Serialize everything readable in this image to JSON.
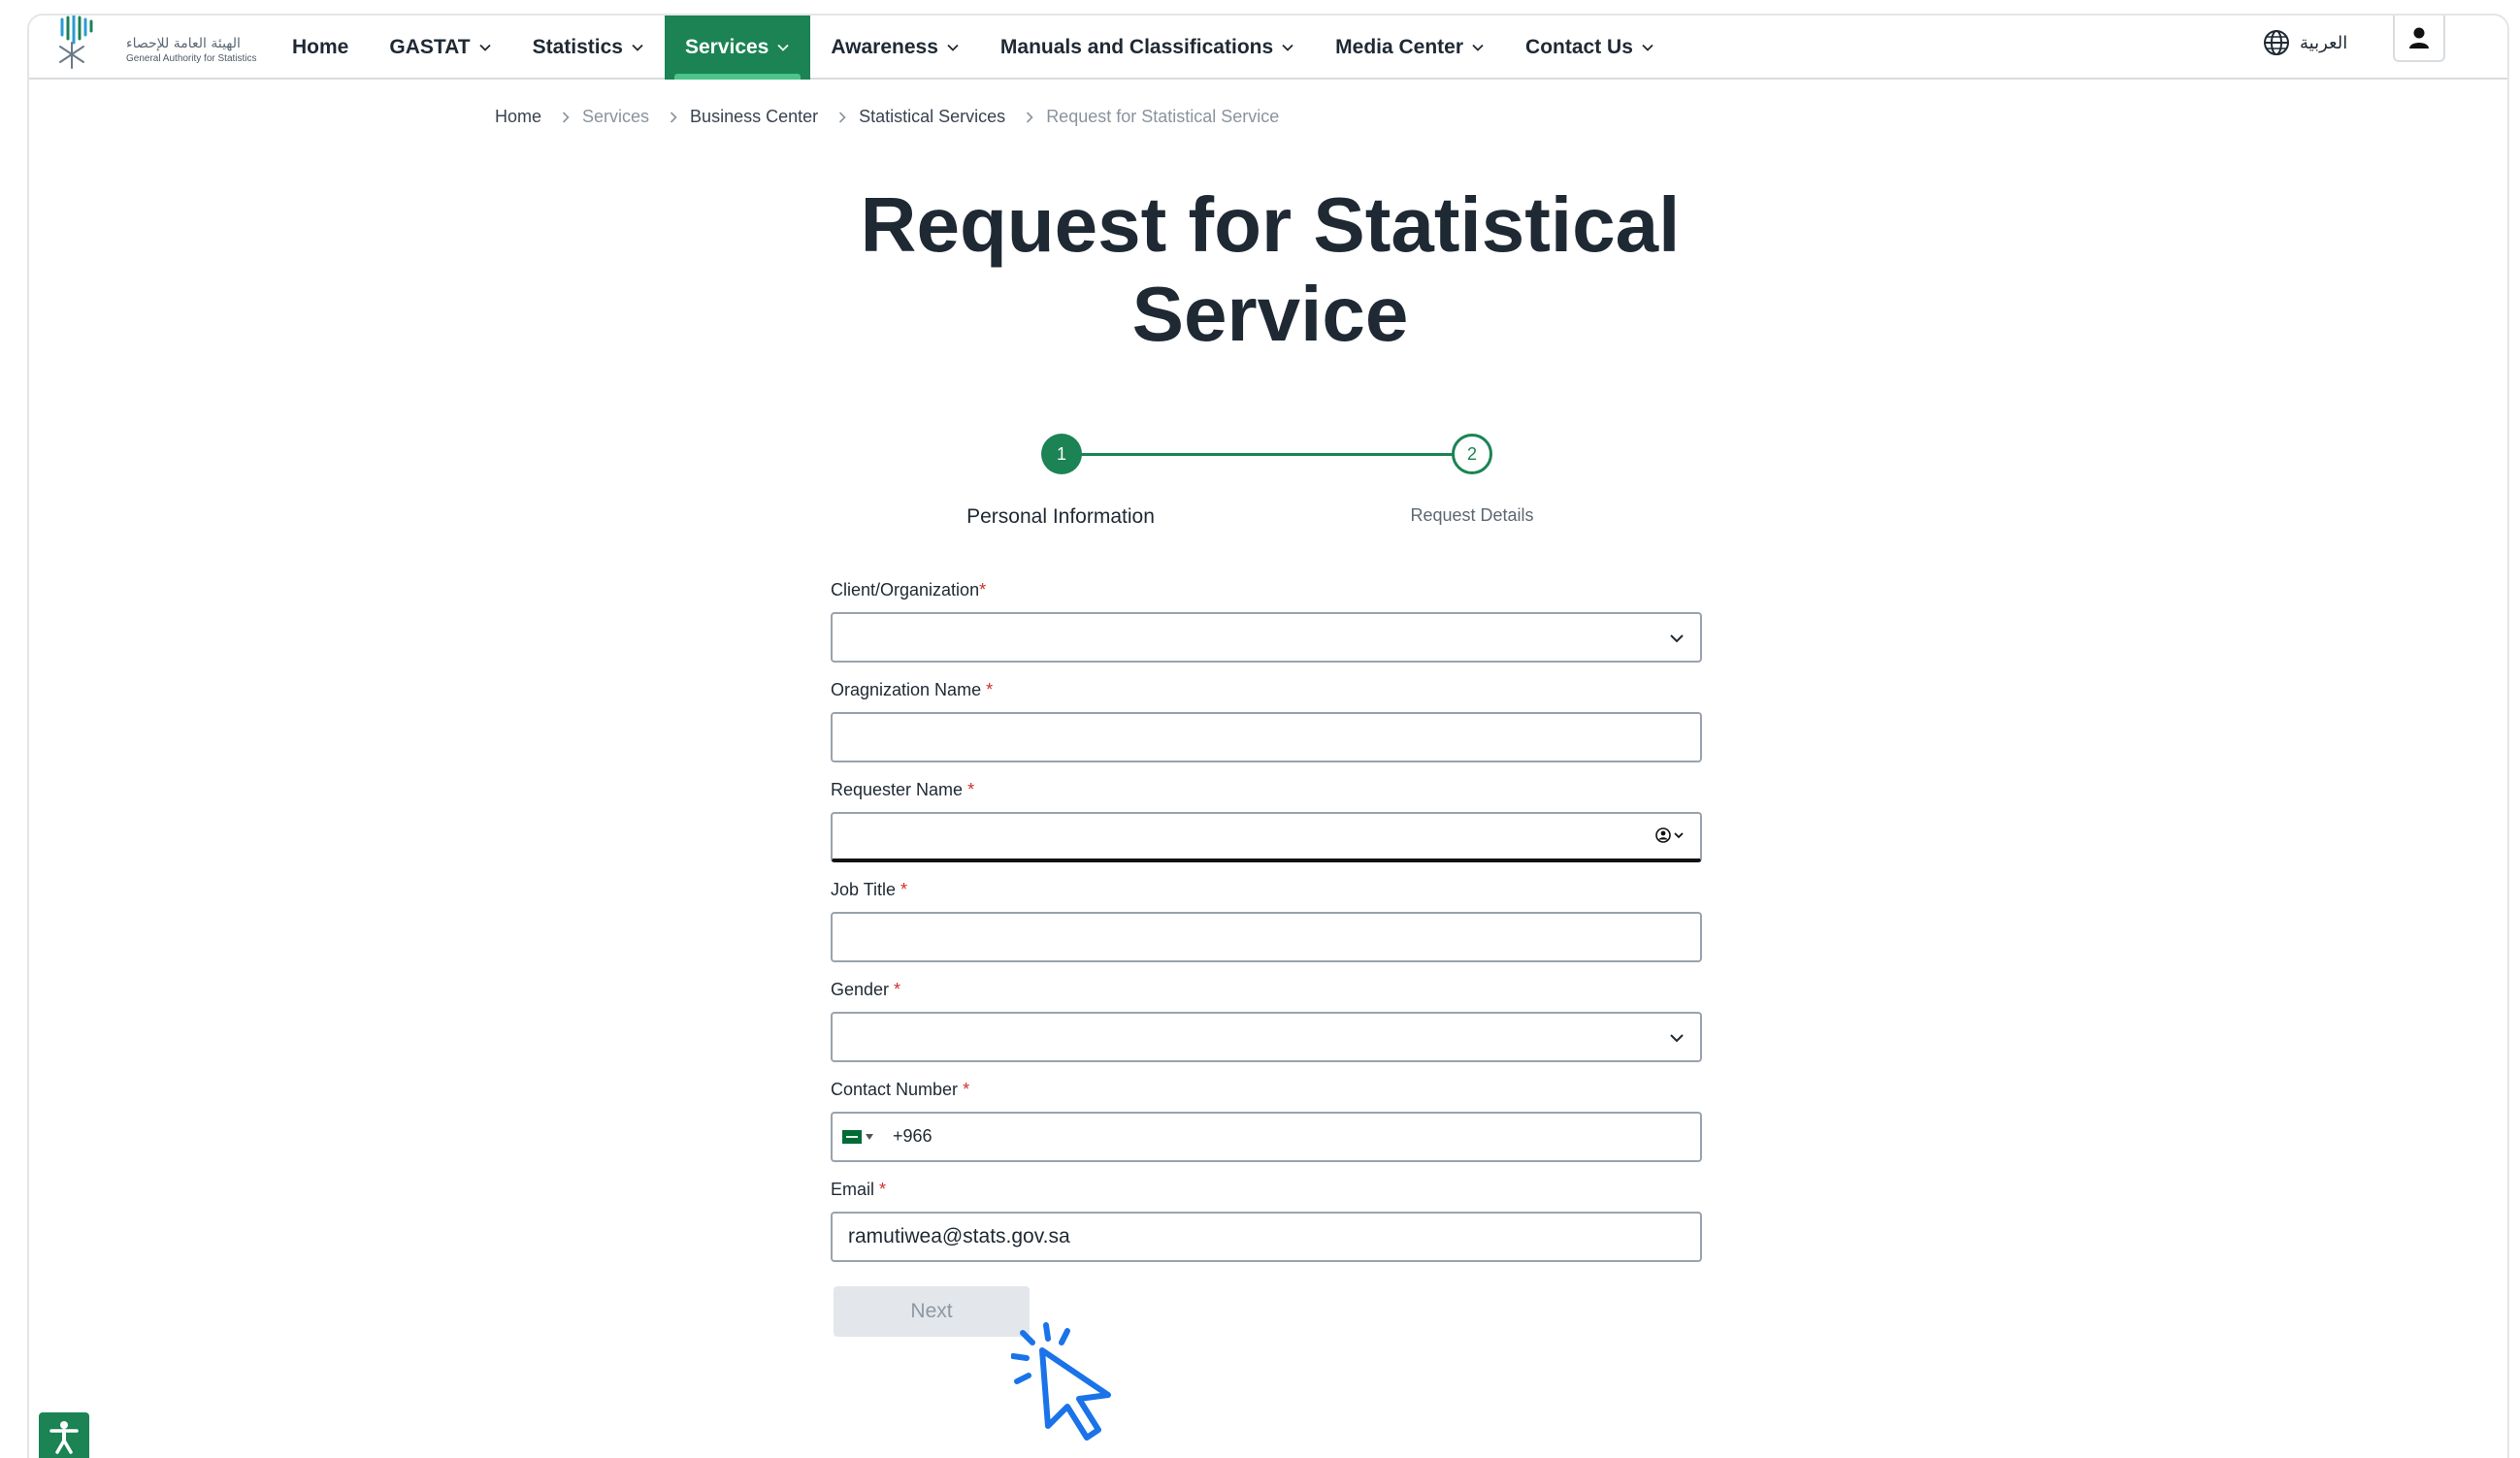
{
  "header": {
    "logo": {
      "name_ar": "الهيئة العامة للإحصاء",
      "name_en": "General Authority for Statistics"
    },
    "nav": [
      {
        "label": "Home",
        "has_dropdown": false,
        "active": false
      },
      {
        "label": "GASTAT",
        "has_dropdown": true,
        "active": false
      },
      {
        "label": "Statistics",
        "has_dropdown": true,
        "active": false
      },
      {
        "label": "Services",
        "has_dropdown": true,
        "active": true
      },
      {
        "label": "Awareness",
        "has_dropdown": true,
        "active": false
      },
      {
        "label": "Manuals and Classifications",
        "has_dropdown": true,
        "active": false
      },
      {
        "label": "Media Center",
        "has_dropdown": true,
        "active": false
      },
      {
        "label": "Contact Us",
        "has_dropdown": true,
        "active": false
      }
    ],
    "language_label": "العربية",
    "language_icon": "globe-icon",
    "user_icon": "user-icon"
  },
  "breadcrumb": [
    {
      "label": "Home"
    },
    {
      "label": "Services"
    },
    {
      "label": "Business Center"
    },
    {
      "label": "Statistical Services"
    },
    {
      "label": "Request for Statistical Service"
    }
  ],
  "page_title_line1": "Request for Statistical",
  "page_title_line2": "Service",
  "stepper": {
    "steps": [
      {
        "number": "1",
        "label": "Personal Information",
        "state": "current"
      },
      {
        "number": "2",
        "label": "Request Details",
        "state": "upcoming"
      }
    ]
  },
  "form": {
    "client_org": {
      "label": "Client/Organization",
      "required_mark": "*",
      "value": ""
    },
    "org_name": {
      "label": "Oragnization Name ",
      "required_mark": "*",
      "value": ""
    },
    "requester_name": {
      "label": "Requester Name ",
      "required_mark": "*",
      "value": ""
    },
    "job_title": {
      "label": "Job Title ",
      "required_mark": "*",
      "value": ""
    },
    "gender": {
      "label": "Gender ",
      "required_mark": "*",
      "value": ""
    },
    "contact_number": {
      "label": "Contact Number ",
      "required_mark": "*",
      "country_code": "+966",
      "value": ""
    },
    "email": {
      "label": "Email ",
      "required_mark": "*",
      "value": "ramutiwea@stats.gov.sa"
    },
    "next_label": "Next"
  },
  "colors": {
    "brand_green": "#1b8354",
    "accent_green": "#4cc48a",
    "required_red": "#d02e2e",
    "disabled_button": "#e3e6ea",
    "cursor_blue": "#1a73e8"
  }
}
